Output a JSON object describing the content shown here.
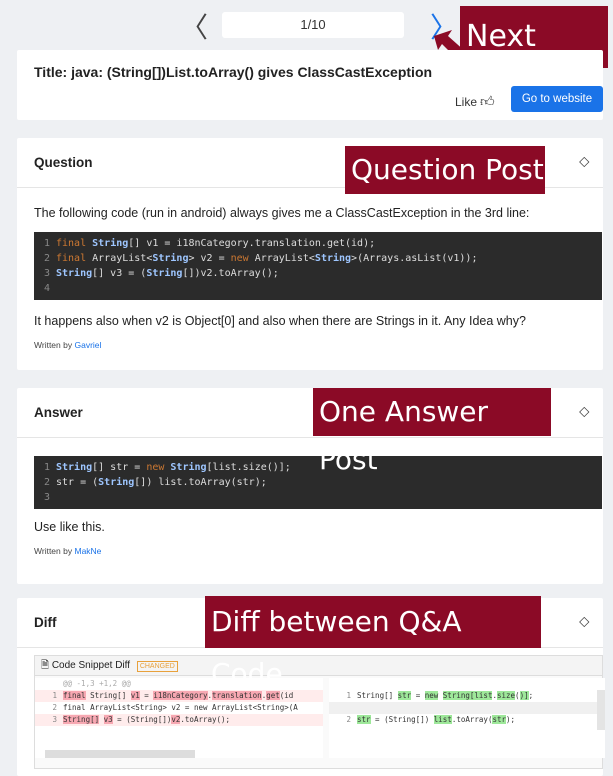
{
  "nav": {
    "prev_icon": "chevron-left-icon",
    "counter": "1/10",
    "next_icon": "chevron-right-icon"
  },
  "callouts": {
    "next": "Next post",
    "question": "Question Post",
    "answer": "One Answer Post",
    "diff": "Diff between Q&A Code"
  },
  "title_card": {
    "title": "Title: java: (String[])List.toArray() gives ClassCastException",
    "like_label": "Like",
    "go_button": "Go to website"
  },
  "question": {
    "label": "Question",
    "intro": "The following code (run in android) always gives me a ClassCastException in the 3rd line:",
    "code": [
      {
        "n": "1",
        "text": "final String[] v1 = i18nCategory.translation.get(id);"
      },
      {
        "n": "2",
        "text": "final ArrayList<String> v2 = new ArrayList<String>(Arrays.asList(v1));"
      },
      {
        "n": "3",
        "text": "String[] v3 = (String[])v2.toArray();"
      },
      {
        "n": "4",
        "text": ""
      }
    ],
    "outro": "It happens also when v2 is Object[0] and also when there are Strings in it. Any Idea why?",
    "written_by": "Written by",
    "author": "Gavriel"
  },
  "answer": {
    "label": "Answer",
    "code": [
      {
        "n": "1",
        "text": "String[] str = new String[list.size()];"
      },
      {
        "n": "2",
        "text": "str = (String[]) list.toArray(str);"
      },
      {
        "n": "3",
        "text": ""
      }
    ],
    "outro": "Use like this.",
    "written_by": "Written by",
    "author": "MakNe"
  },
  "diff": {
    "label": "Diff",
    "box_title": "Code Snippet Diff",
    "badge": "CHANGED",
    "hunk": "@@ -1,3 +1,2 @@",
    "left_lines": [
      {
        "n": "1",
        "text": "final String[] v1 = i18nCategory.translation.get(id"
      },
      {
        "n": "2",
        "text": "final ArrayList<String> v2 = new ArrayList<String>(A"
      },
      {
        "n": "3",
        "text": "String[] v3 = (String[])v2.toArray();"
      }
    ],
    "right_lines": [
      {
        "n": "1",
        "text": "String[] str = new String[list.size()];"
      },
      {
        "n": "2",
        "text": "str = (String[]) list.toArray(str);"
      }
    ]
  },
  "colors": {
    "callout_bg": "#8b0a26",
    "accent": "#1a73e8",
    "code_bg": "#2b2b2b"
  }
}
